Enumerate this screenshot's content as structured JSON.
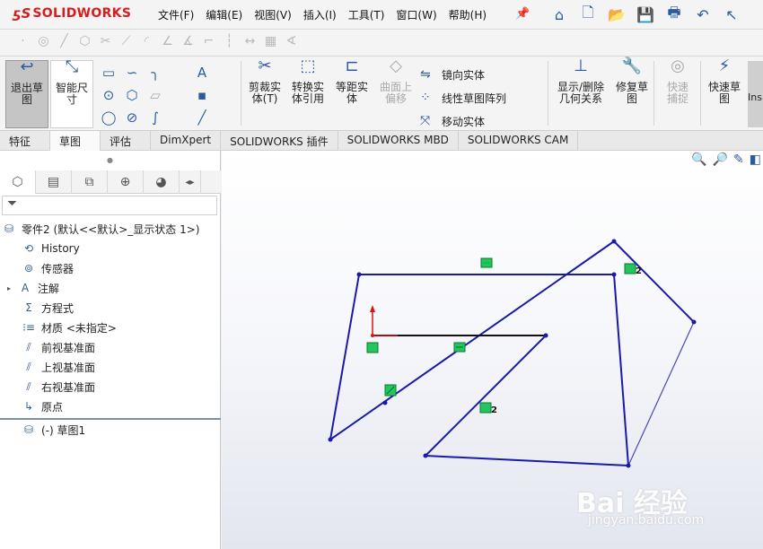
{
  "app": {
    "logo_mark": "ƽS",
    "logo_text": "SOLIDWORKS"
  },
  "menu": [
    "文件(F)",
    "编辑(E)",
    "视图(V)",
    "插入(I)",
    "工具(T)",
    "窗口(W)",
    "帮助(H)"
  ],
  "commands": {
    "exit_sketch": "退出草图",
    "smart_dim": "智能尺寸",
    "trim": "剪裁实体(T)",
    "convert": "转换实体引用",
    "offset": "等距实体",
    "surface_offset": "曲面上偏移",
    "mirror": "镜向实体",
    "linear_pattern": "线性草图阵列",
    "move": "移动实体",
    "display_relations": "显示/删除几何关系",
    "repair_sketch": "修复草图",
    "quick_snaps": "快速捕捉",
    "rapid_sketch": "快速草图",
    "ins": "Ins"
  },
  "tabs": [
    "特征",
    "草图",
    "评估",
    "DimXpert",
    "SOLIDWORKS 插件",
    "SOLIDWORKS MBD",
    "SOLIDWORKS CAM"
  ],
  "active_tab": "草图",
  "tree": {
    "root": "零件2 (默认<<默认>_显示状态 1>)",
    "items": [
      "History",
      "传感器",
      "注解",
      "方程式",
      "材质 <未指定>",
      "前视基准面",
      "上视基准面",
      "右视基准面",
      "原点"
    ],
    "sketch": "(-) 草图1"
  },
  "sketch_labels": {
    "parallel_1": "2",
    "parallel_2": "2"
  },
  "watermark": {
    "main": "Bai  经验",
    "sub": "jingyan.baidu.com"
  },
  "colors": {
    "sketch_line": "#1a1aa8",
    "relation_green": "#22c55e",
    "logo_red": "#d71e1e"
  }
}
